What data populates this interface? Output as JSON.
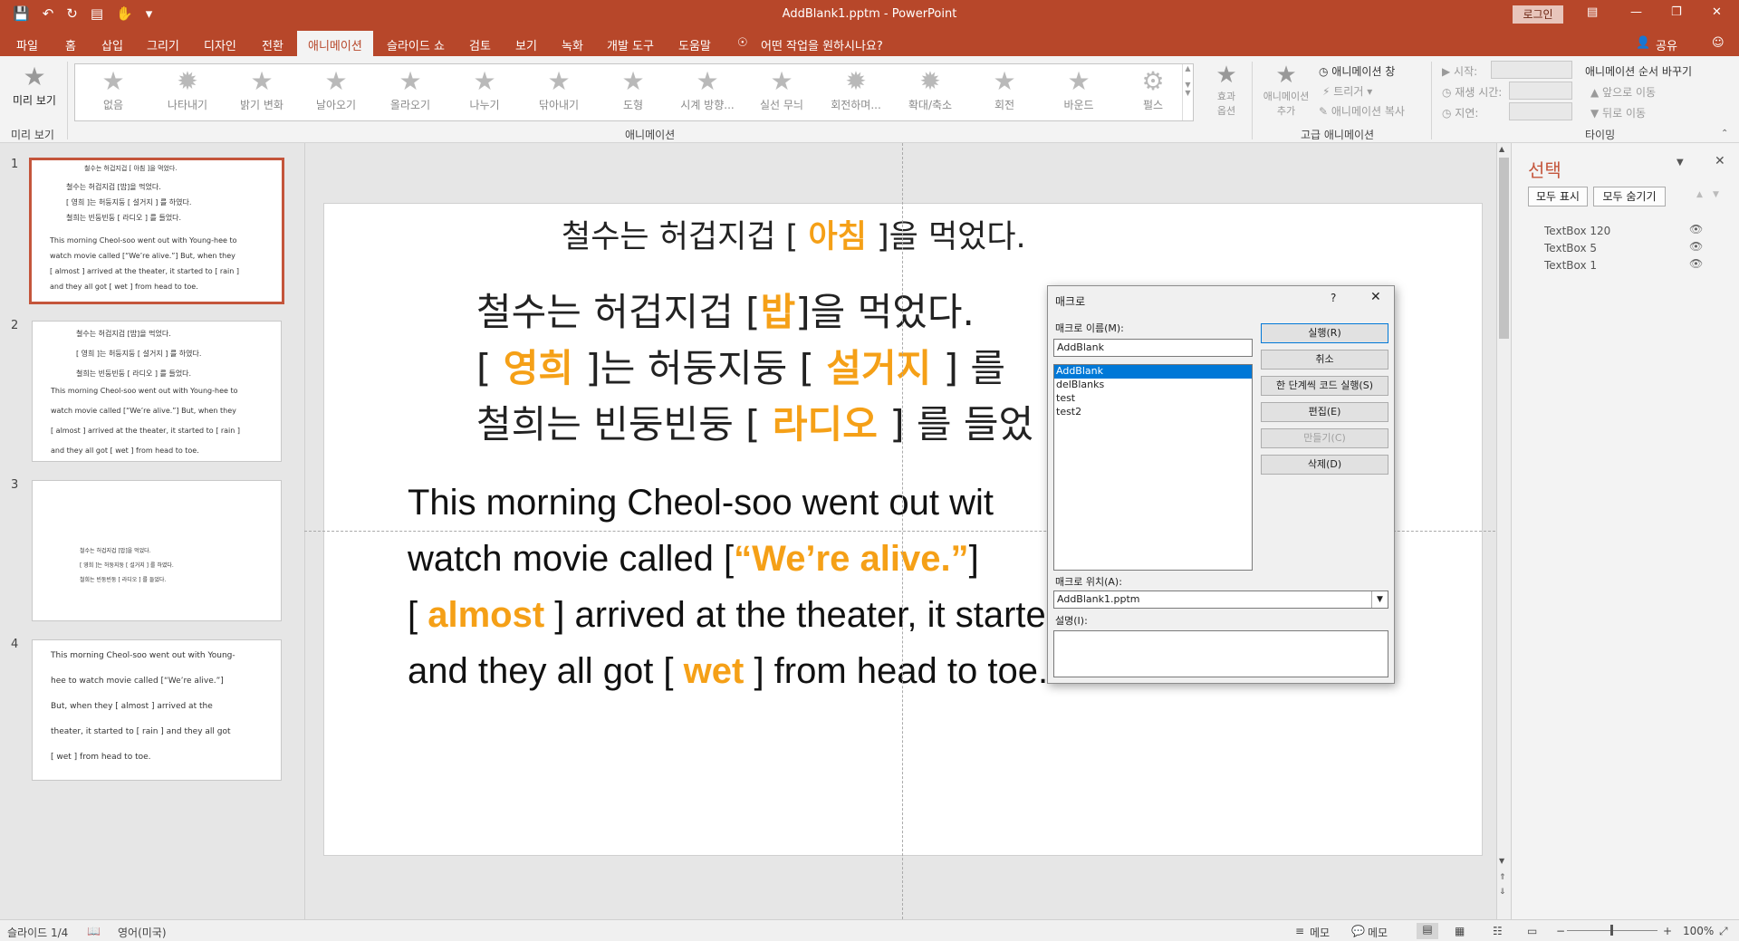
{
  "window": {
    "title": "AddBlank1.pptm  -  PowerPoint",
    "login": "로그인"
  },
  "tabs": [
    "파일",
    "홈",
    "삽입",
    "그리기",
    "디자인",
    "전환",
    "애니메이션",
    "슬라이드 쇼",
    "검토",
    "보기",
    "녹화",
    "개발 도구",
    "도움말"
  ],
  "active_tab": "애니메이션",
  "tell_me": "어떤 작업을 원하시나요?",
  "share": "공유",
  "ribbon": {
    "preview_label": "미리 보기",
    "preview_group": "미리 보기",
    "animations_group": "애니메이션",
    "advanced_group": "고급 애니메이션",
    "timing_group": "타이밍",
    "gallery": [
      "없음",
      "나타내기",
      "밝기 변화",
      "날아오기",
      "올라오기",
      "나누기",
      "닦아내기",
      "도형",
      "시계 방향...",
      "실선 무늬",
      "회전하며...",
      "확대/축소",
      "회전",
      "바운드",
      "펄스"
    ],
    "effect_options": "효과\n옵션",
    "add_animation": "애니메이션\n추가",
    "animation_pane": "애니메이션 창",
    "trigger": "트리거",
    "animation_painter": "애니메이션 복사",
    "start_label": "시작:",
    "duration_label": "재생 시간:",
    "delay_label": "지연:",
    "reorder_label": "애니메이션 순서 바꾸기",
    "move_earlier": "앞으로 이동",
    "move_later": "뒤로 이동"
  },
  "thumbnails": [
    {
      "number": "1",
      "lines": [
        "철수는 허겁지겁 [ 아침 ]을 먹었다.",
        "철수는 허겁지겁 [밥]을 먹었다.",
        "[ 영희 ]는 허둥지둥 [ 설거지 ] 를 하였다.",
        "철희는 빈둥빈둥 [ 라디오 ] 를 들었다.",
        "This morning Cheol-soo went out with Young-hee to",
        "watch movie called [“We’re alive.”] But, when they",
        "[ almost ] arrived at the theater, it started to [ rain ]",
        "and they all got [ wet ] from head to toe."
      ]
    },
    {
      "number": "2",
      "lines": [
        "철수는 허겁지겁 [밥]을 먹었다.",
        "[ 영희 ]는 허둥지둥 [ 설거지 ] 를 하였다.",
        "철희는 빈둥빈둥 [ 라디오 ] 를 들었다.",
        "This morning Cheol-soo went out with Young-hee to",
        "watch movie called [“We’re alive.”] But, when they",
        "[ almost ] arrived at the theater, it started to [ rain ]",
        "and they all got [ wet ] from head to toe."
      ]
    },
    {
      "number": "3",
      "lines": [
        "철수는 허겁지겁 [밥]을 먹었다.",
        "[ 영희 ]는 허둥지둥 [ 설거지 ] 를 하였다.",
        "철희는 빈둥빈둥 [ 라디오 ] 를 들었다."
      ]
    },
    {
      "number": "4",
      "lines": [
        "This morning Cheol-soo went out with Young-",
        "hee to watch movie called [“We’re alive.”]",
        "But, when they [ almost ] arrived at the",
        "theater, it started to [ rain ] and they all got",
        "[ wet ] from head to toe."
      ]
    }
  ],
  "slide": {
    "line_top": {
      "pre": "철수는 허겁지겁 [ ",
      "blank": "아침",
      "post": " ]을 먹었다."
    },
    "line1": {
      "pre": "철수는 허겁지겁 [",
      "blank": "밥",
      "post": "]을 먹었다."
    },
    "line2": {
      "b1_open": "[ ",
      "blank1": "영희",
      "mid": " ]는 허둥지둥 [ ",
      "blank2": "설거지",
      "post": " ] 를"
    },
    "line3": {
      "pre": "철희는 빈둥빈둥 [ ",
      "blank": "라디오",
      "post": " ] 를 들었"
    },
    "en1": "This morning Cheol-soo went out wit",
    "en2": {
      "pre": "watch movie called [",
      "blank": "“We’re alive.”",
      "post": "]"
    },
    "en3": {
      "open": "[ ",
      "blank1": "almost",
      "mid": " ]  arrived at the theater, it started to [ ",
      "blank2": "rain",
      "post": " ]"
    },
    "en4": {
      "pre": "and they all got [ ",
      "blank": "wet",
      "post": " ] from head to toe."
    }
  },
  "selection_pane": {
    "title": "선택",
    "show_all": "모두 표시",
    "hide_all": "모두 숨기기",
    "items": [
      "TextBox 120",
      "TextBox 5",
      "TextBox 1"
    ]
  },
  "dialog": {
    "title": "매크로",
    "help": "?",
    "name_label": "매크로 이름(M):",
    "name_value": "AddBlank",
    "macros": [
      "AddBlank",
      "delBlanks",
      "test",
      "test2"
    ],
    "selected_macro": "AddBlank",
    "buttons": {
      "run": "실행(R)",
      "cancel": "취소",
      "step_into": "한 단계씩 코드 실행(S)",
      "edit": "편집(E)",
      "create": "만들기(C)",
      "delete": "삭제(D)"
    },
    "location_label": "매크로 위치(A):",
    "location_value": "AddBlank1.pptm",
    "description_label": "설명(I):"
  },
  "status": {
    "slide": "슬라이드 1/4",
    "language": "영어(미국)",
    "notes1": "메모",
    "notes2": "메모",
    "zoom": "100%"
  },
  "colors": {
    "accent": "#b7472a",
    "blank_text": "#f5a017"
  }
}
